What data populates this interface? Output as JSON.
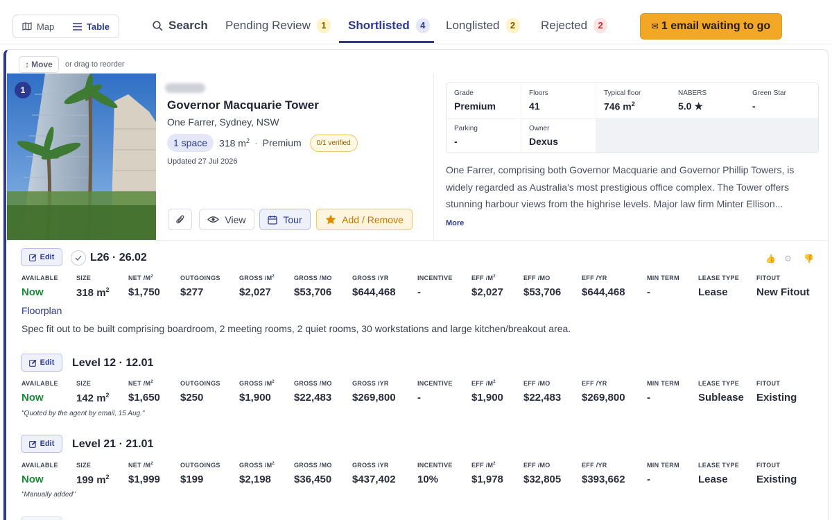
{
  "topbar": {
    "view_map": "Map",
    "view_table": "Table",
    "search": "Search",
    "tabs": [
      {
        "label": "Pending Review",
        "count": "1"
      },
      {
        "label": "Shortlisted",
        "count": "4"
      },
      {
        "label": "Longlisted",
        "count": "2"
      },
      {
        "label": "Rejected",
        "count": "2"
      }
    ],
    "email_button": "1 email waiting to go",
    "email_icon": "✉"
  },
  "card": {
    "move_label": "Move",
    "drag_hint": "or drag to reorder",
    "rank": "1",
    "building_name": "Governor Macquarie Tower",
    "address": "One Farrer, Sydney, NSW",
    "spaces_pill": "1 space",
    "area": "318 m",
    "grade": "Premium",
    "verified": "0/1 verified",
    "updated": "Updated 27 Jul 2026",
    "actions": {
      "view": "View",
      "tour": "Tour",
      "add_remove": "Add / Remove"
    },
    "specs": [
      {
        "k": "Grade",
        "v": "Premium"
      },
      {
        "k": "Floors",
        "v": "41"
      },
      {
        "k": "Typical floor",
        "v": "746 m"
      },
      {
        "k": "NABERS",
        "v": "5.0 ★"
      },
      {
        "k": "Green Star",
        "v": "-"
      },
      {
        "k": "Parking",
        "v": "-"
      },
      {
        "k": "Owner",
        "v": "Dexus"
      }
    ],
    "description": "One Farrer, comprising both Governor Macquarie and Governor Phillip Towers, is widely regarded as Australia's most prestigious office complex. The Tower offers stunning harbour views from the highrise levels. Major law firm Minter Ellison...",
    "more": "More"
  },
  "headers": {
    "available": "AVAILABLE",
    "size": "SIZE",
    "net": "NET /M",
    "outgoings": "OUTGOINGS",
    "gross_m2": "GROSS /M",
    "gross_mo": "GROSS /MO",
    "gross_yr": "GROSS /YR",
    "incentive": "INCENTIVE",
    "eff_m2": "EFF /M",
    "eff_mo": "EFF /MO",
    "eff_yr": "EFF /YR",
    "min_term": "MIN TERM",
    "lease_type": "LEASE TYPE",
    "fitout": "FITOUT"
  },
  "edit_label": "Edit",
  "superscript_2": "2",
  "spaces": [
    {
      "title": "L26 · 26.02",
      "available": "Now",
      "size": "318 m",
      "net": "$1,750",
      "outgoings": "$277",
      "gross_m2": "$2,027",
      "gross_mo": "$53,706",
      "gross_yr": "$644,468",
      "incentive": "-",
      "eff_m2": "$2,027",
      "eff_mo": "$53,706",
      "eff_yr": "$644,468",
      "min_term": "-",
      "lease_type": "Lease",
      "fitout": "New Fitout",
      "floorplan": "Floorplan",
      "note": "Spec fit out to be built comprising boardroom, 2 meeting rooms, 2 quiet rooms, 30 workstations and large kitchen/breakout area."
    },
    {
      "title": "Level 12 · 12.01",
      "available": "Now",
      "size": "142 m",
      "net": "$1,650",
      "outgoings": "$250",
      "gross_m2": "$1,900",
      "gross_mo": "$22,483",
      "gross_yr": "$269,800",
      "incentive": "-",
      "eff_m2": "$1,900",
      "eff_mo": "$22,483",
      "eff_yr": "$269,800",
      "min_term": "-",
      "lease_type": "Sublease",
      "fitout": "Existing",
      "quote": "\"Quoted by the agent by email, 15 Aug.\""
    },
    {
      "title": "Level 21 · 21.01",
      "available": "Now",
      "size": "199 m",
      "net": "$1,999",
      "outgoings": "$199",
      "gross_m2": "$2,198",
      "gross_mo": "$36,450",
      "gross_yr": "$437,402",
      "incentive": "10%",
      "eff_m2": "$1,978",
      "eff_mo": "$32,805",
      "eff_yr": "$393,662",
      "min_term": "-",
      "lease_type": "Lease",
      "fitout": "Existing",
      "quote": "\"Manually added\""
    }
  ],
  "colors": {
    "accent": "#2b3990",
    "cta": "#f2a826",
    "available": "#1a8a3a"
  }
}
